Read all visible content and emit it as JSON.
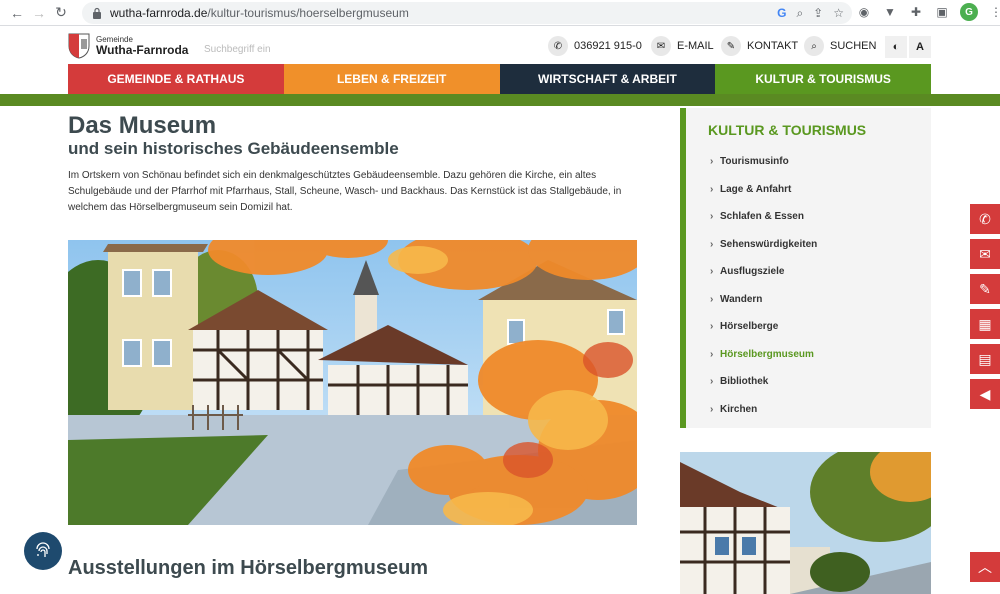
{
  "browser": {
    "url_host": "wutha-farnroda.de",
    "url_path": "/kultur-tourismus/hoerselbergmuseum",
    "avatar_letter": "G"
  },
  "header": {
    "logo_small": "Gemeinde",
    "logo_big": "Wutha-Farnroda",
    "search_placeholder": "Suchbegriff ein",
    "phone": "036921 915-0",
    "mail": "E-MAIL",
    "contact": "KONTAKT",
    "search": "SUCHEN",
    "font_toggle": "A"
  },
  "nav": {
    "items": [
      {
        "label": "GEMEINDE & RATHAUS"
      },
      {
        "label": "LEBEN & FREIZEIT"
      },
      {
        "label": "WIRTSCHAFT & ARBEIT"
      },
      {
        "label": "KULTUR & TOURISMUS"
      }
    ]
  },
  "main": {
    "title": "Das Museum",
    "subtitle": "und sein historisches Gebäudeensemble",
    "intro": "Im Ortskern von Schönau befindet sich ein denkmalgeschütztes Gebäudeensemble. Dazu gehören die Kirche, ein altes Schulgebäude und der Pfarrhof mit Pfarrhaus, Stall, Scheune, Wasch- und Backhaus. Das Kernstück ist das Stallgebäude, in welchem das Hörselbergmuseum sein Domizil hat.",
    "section_heading": "Ausstellungen im Hörselbergmuseum"
  },
  "sidebar": {
    "title": "KULTUR & TOURISMUS",
    "items": [
      {
        "label": "Tourismusinfo"
      },
      {
        "label": "Lage & Anfahrt"
      },
      {
        "label": "Schlafen & Essen"
      },
      {
        "label": "Sehenswürdigkeiten"
      },
      {
        "label": "Ausflugsziele"
      },
      {
        "label": "Wandern"
      },
      {
        "label": "Hörselberge"
      },
      {
        "label": "Hörselbergmuseum"
      },
      {
        "label": "Bibliothek"
      },
      {
        "label": "Kirchen"
      }
    ],
    "active_index": 7
  },
  "float": {
    "icons": [
      "phone-icon",
      "mail-icon",
      "pen-icon",
      "calendar-icon",
      "newspaper-icon",
      "megaphone-icon"
    ]
  },
  "colors": {
    "red": "#d43b3b",
    "orange": "#f0902a",
    "navy": "#1e2d3d",
    "green": "#5a9820"
  }
}
